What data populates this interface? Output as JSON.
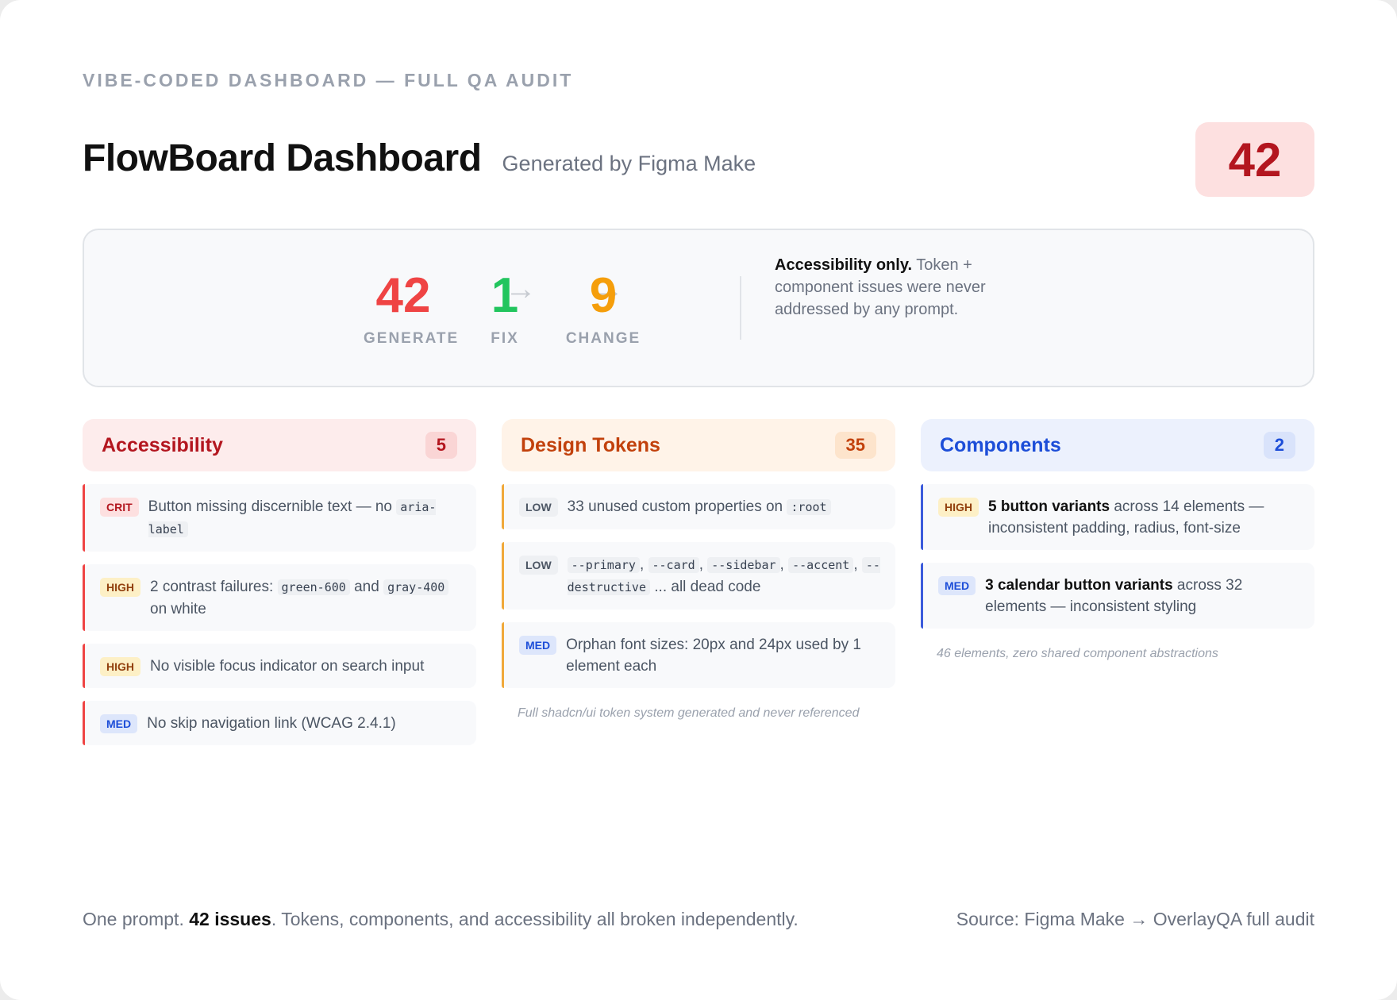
{
  "header": {
    "eyebrow": "VIBE-CODED DASHBOARD — FULL QA AUDIT",
    "title": "FlowBoard Dashboard",
    "subtitle": "Generated by Figma Make",
    "total_issues": "42"
  },
  "summary": {
    "stats": [
      {
        "value": "42",
        "label": "GENERATE",
        "color": "#ef4444"
      },
      {
        "value": "1",
        "label": "FIX",
        "color": "#22c55e"
      },
      {
        "value": "9",
        "label": "CHANGE",
        "color": "#f59e0b"
      }
    ],
    "arrow_icon": "arrow-right-icon",
    "note_bold": "Accessibility only.",
    "note_rest": " Token + component issues were never addressed by any prompt."
  },
  "columns": {
    "accessibility": {
      "name": "Accessibility",
      "count": "5",
      "accent": "#ef4444",
      "items": [
        {
          "tag": "CRIT",
          "p1": "Button missing discernible text — no ",
          "code1": "aria-label"
        },
        {
          "tag": "HIGH",
          "p1": "2 contrast failures: ",
          "code1": "green-600",
          "p2": " and ",
          "code2": "gray-400",
          "p3": " on white"
        },
        {
          "tag": "HIGH",
          "p1": "No visible focus indicator on search input"
        },
        {
          "tag": "MED",
          "p1": "No skip navigation link (WCAG 2.4.1)"
        }
      ]
    },
    "tokens": {
      "name": "Design Tokens",
      "count": "35",
      "accent": "#f0a93a",
      "items": [
        {
          "tag": "LOW",
          "p1": "33 unused custom properties on ",
          "code1": ":root"
        },
        {
          "tag": "LOW",
          "codes": [
            "--primary",
            "--card",
            "--sidebar",
            "--accent",
            "--destructive"
          ],
          "sep": ", ",
          "tail": " ... all dead code"
        },
        {
          "tag": "MED",
          "p1": "Orphan font sizes: 20px and 24px used by 1 element each"
        }
      ],
      "footnote": "Full shadcn/ui token system generated and never referenced"
    },
    "components": {
      "name": "Components",
      "count": "2",
      "accent": "#3b5bdb",
      "items": [
        {
          "tag": "HIGH",
          "bold": "5 button variants",
          "rest": " across 14 elements — inconsistent padding, radius, font-size"
        },
        {
          "tag": "MED",
          "bold": "3 calendar button variants",
          "rest": " across 32 elements — inconsistent styling"
        }
      ],
      "footnote": "46 elements, zero shared component abstractions"
    }
  },
  "footer": {
    "left_pre": "One prompt. ",
    "left_bold": "42 issues",
    "left_post": ". Tokens, components, and accessibility all broken independently.",
    "right": "Source: Figma Make → OverlayQA full audit"
  }
}
